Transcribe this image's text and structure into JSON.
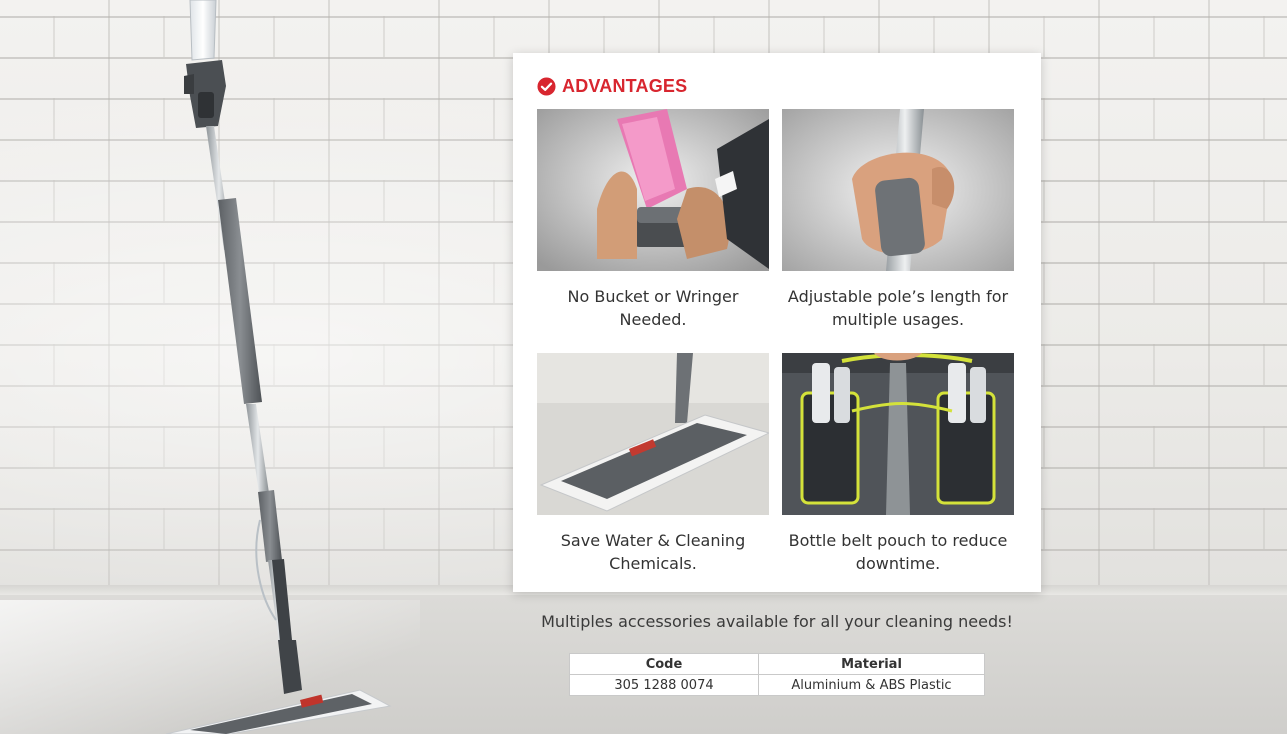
{
  "advantages": {
    "title": "ADVANTAGES",
    "icon": "check-circle-icon",
    "accent": "#d8262f",
    "items": [
      {
        "caption": "No Bucket or Wringer Needed.",
        "image": "hand-twisting-bottle-photo"
      },
      {
        "caption": "Adjustable pole’s length for multiple usages.",
        "image": "hand-gripping-pole-photo"
      },
      {
        "caption": "Save Water & Cleaning Chemicals.",
        "image": "mop-on-floor-photo"
      },
      {
        "caption": "Bottle belt pouch to reduce downtime.",
        "image": "bottle-belt-pouch-photo"
      }
    ]
  },
  "tagline": "Multiples accessories available for all your cleaning needs!",
  "spec_table": {
    "headers": [
      "Code",
      "Material"
    ],
    "rows": [
      [
        "305 1288 0074",
        "Aluminium & ABS Plastic"
      ]
    ]
  }
}
